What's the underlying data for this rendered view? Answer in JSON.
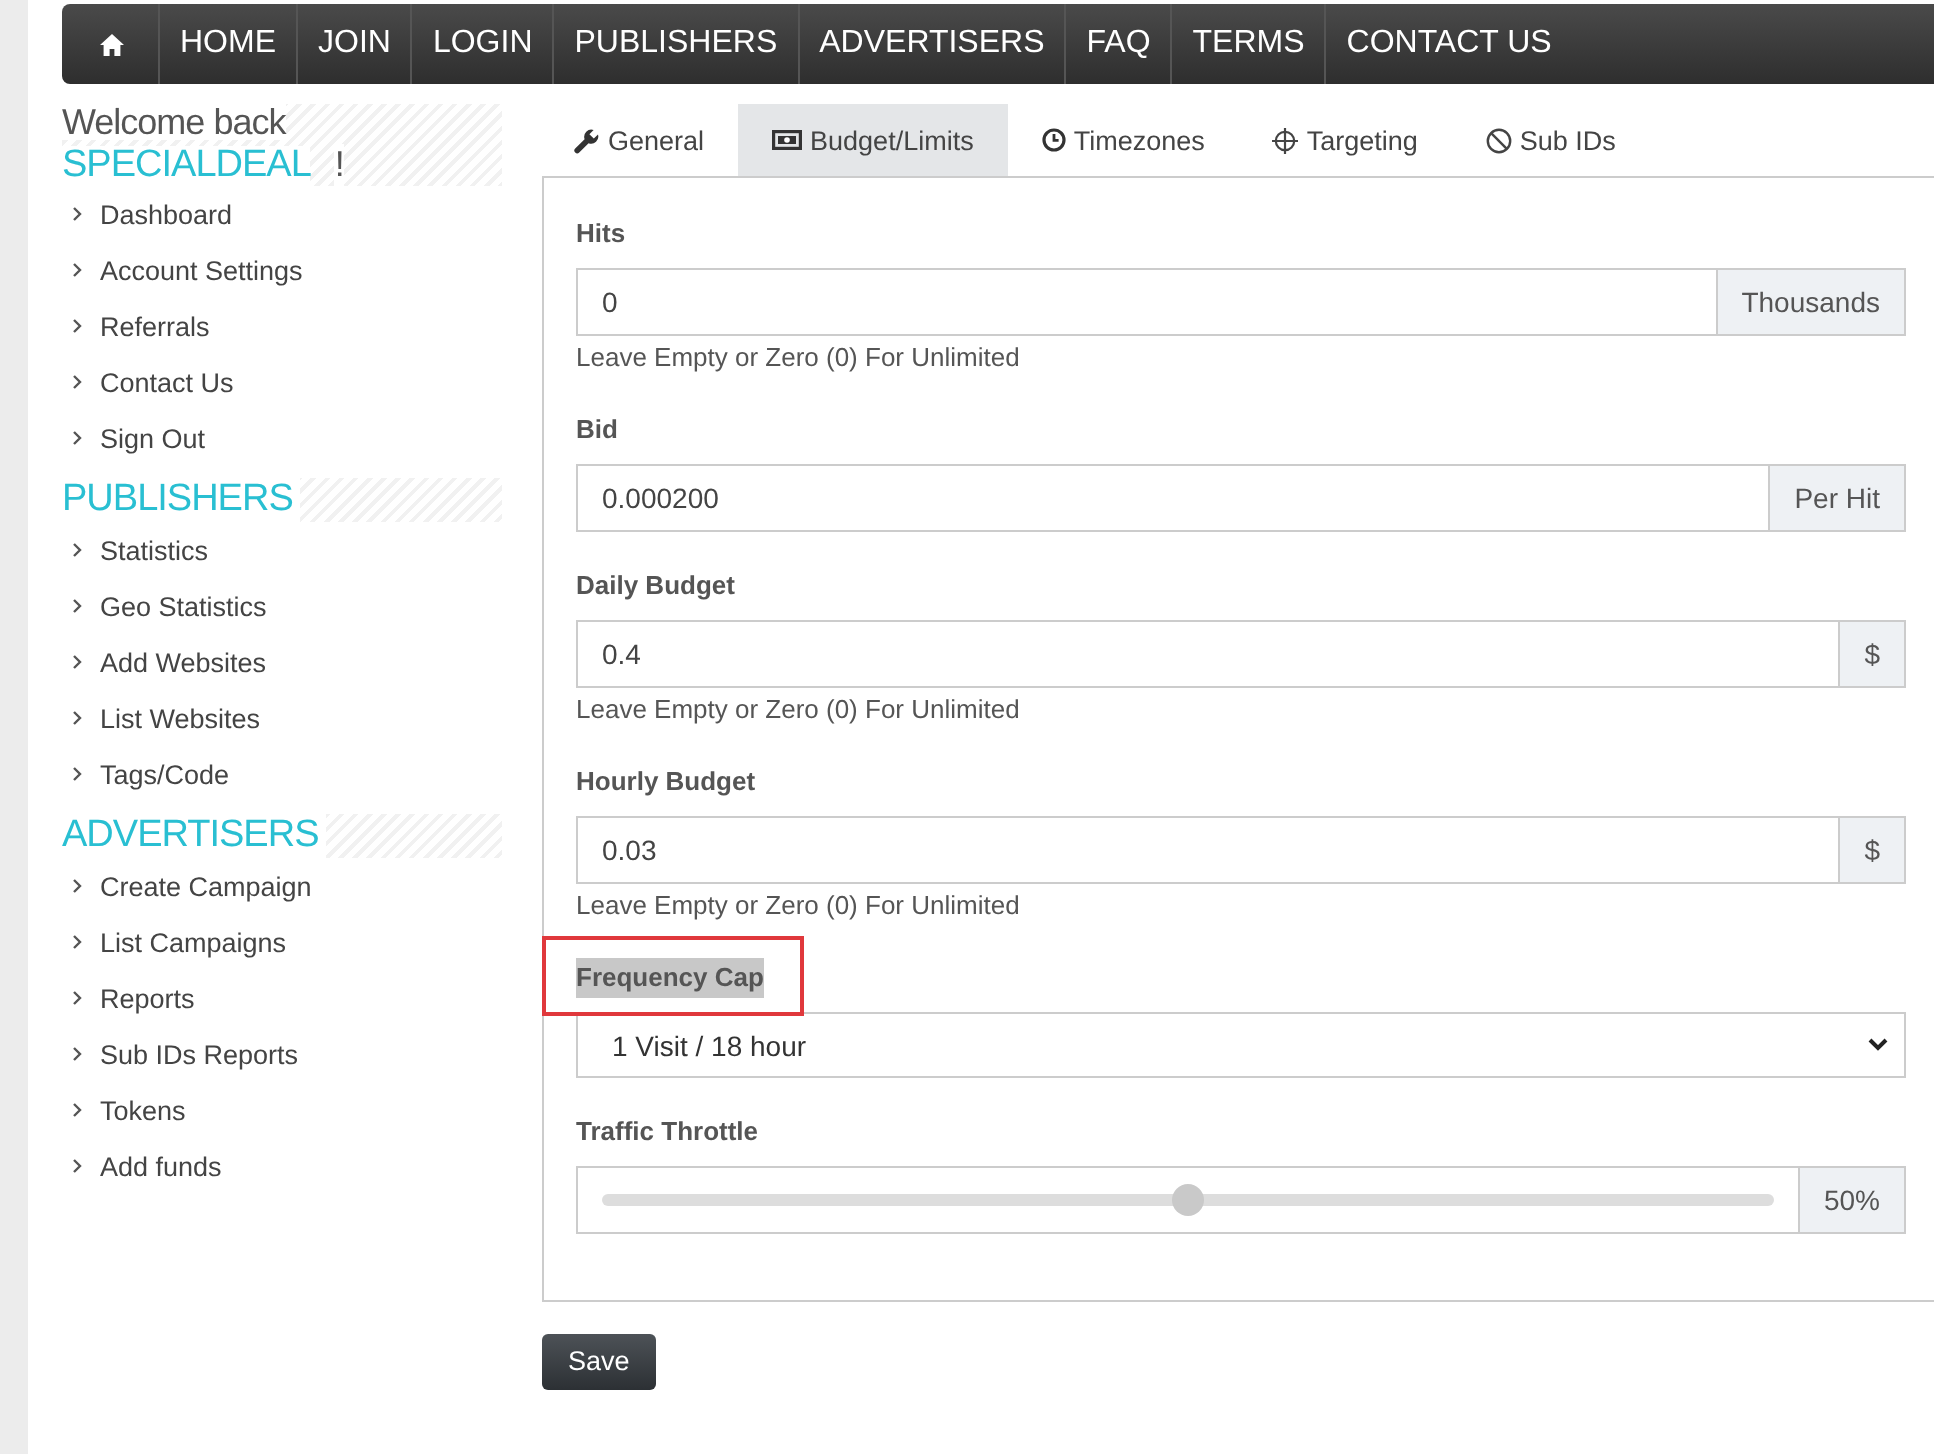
{
  "nav": {
    "items": [
      "HOME",
      "JOIN",
      "LOGIN",
      "PUBLISHERS",
      "ADVERTISERS",
      "FAQ",
      "TERMS",
      "CONTACT US"
    ]
  },
  "sidebar": {
    "welcome": "Welcome back",
    "username": "SPECIALDEAL",
    "exclamation": "!",
    "account_links": [
      "Dashboard",
      "Account Settings",
      "Referrals",
      "Contact Us",
      "Sign Out"
    ],
    "sections": [
      {
        "title": "PUBLISHERS",
        "links": [
          "Statistics",
          "Geo Statistics",
          "Add Websites",
          "List Websites",
          "Tags/Code"
        ]
      },
      {
        "title": "ADVERTISERS",
        "links": [
          "Create Campaign",
          "List Campaigns",
          "Reports",
          "Sub IDs Reports",
          "Tokens",
          "Add funds"
        ]
      }
    ]
  },
  "tabs": [
    {
      "label": "General",
      "selected": false
    },
    {
      "label": "Budget/Limits",
      "selected": true
    },
    {
      "label": "Timezones",
      "selected": false
    },
    {
      "label": "Targeting",
      "selected": false
    },
    {
      "label": "Sub IDs",
      "selected": false
    }
  ],
  "fields": [
    {
      "kind": "input",
      "label": "Hits",
      "value": "0",
      "addon": "Thousands",
      "help": "Leave Empty or Zero (0) For Unlimited"
    },
    {
      "kind": "input",
      "label": "Bid",
      "value": "0.000200",
      "addon": "Per Hit"
    },
    {
      "kind": "input",
      "label": "Daily Budget",
      "value": "0.4",
      "addon": "$",
      "help": "Leave Empty or Zero (0) For Unlimited"
    },
    {
      "kind": "input",
      "label": "Hourly Budget",
      "value": "0.03",
      "addon": "$",
      "help": "Leave Empty or Zero (0) For Unlimited"
    },
    {
      "kind": "select",
      "label": "Frequency Cap",
      "value": "1 Visit / 18 hour",
      "highlighted": true
    },
    {
      "kind": "slider",
      "label": "Traffic Throttle",
      "level": 0.5,
      "addon": "50%"
    }
  ],
  "save_button": "Save"
}
